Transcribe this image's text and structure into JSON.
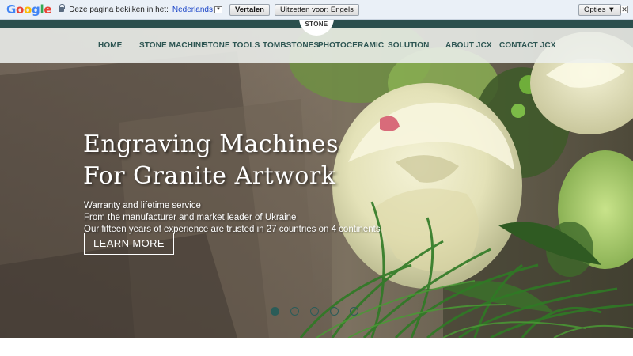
{
  "translate_bar": {
    "logo": "Google",
    "prompt": "Deze pagina bekijken in het:",
    "language": "Nederlands",
    "translate_button": "Vertalen",
    "disable_button": "Uitzetten voor: Engels",
    "options_button": "Opties ▼",
    "close_symbol": "✕"
  },
  "header": {
    "logo_text": "STONE",
    "nav": [
      "HOME",
      "STONE MACHINE",
      "STONE TOOLS",
      "TOMBSTONES",
      "PHOTOCERAMIC",
      "SOLUTION",
      "ABOUT JCX",
      "CONTACT JCX"
    ]
  },
  "hero": {
    "title_line1": "Engraving Machines",
    "title_line2": "For Granite Artwork",
    "line1": "Warranty and lifetime service",
    "line2": "From the manufacturer and market leader of Ukraine",
    "line3": "Our fifteen years of experience are trusted in 27 countries on 4 continents",
    "cta": "LEARN MORE",
    "slides_total": 5,
    "active_slide": 1
  },
  "colors": {
    "brand_dark": "#2b4f4d",
    "nav_text": "#2d5552",
    "dot": "#2b5c58"
  }
}
